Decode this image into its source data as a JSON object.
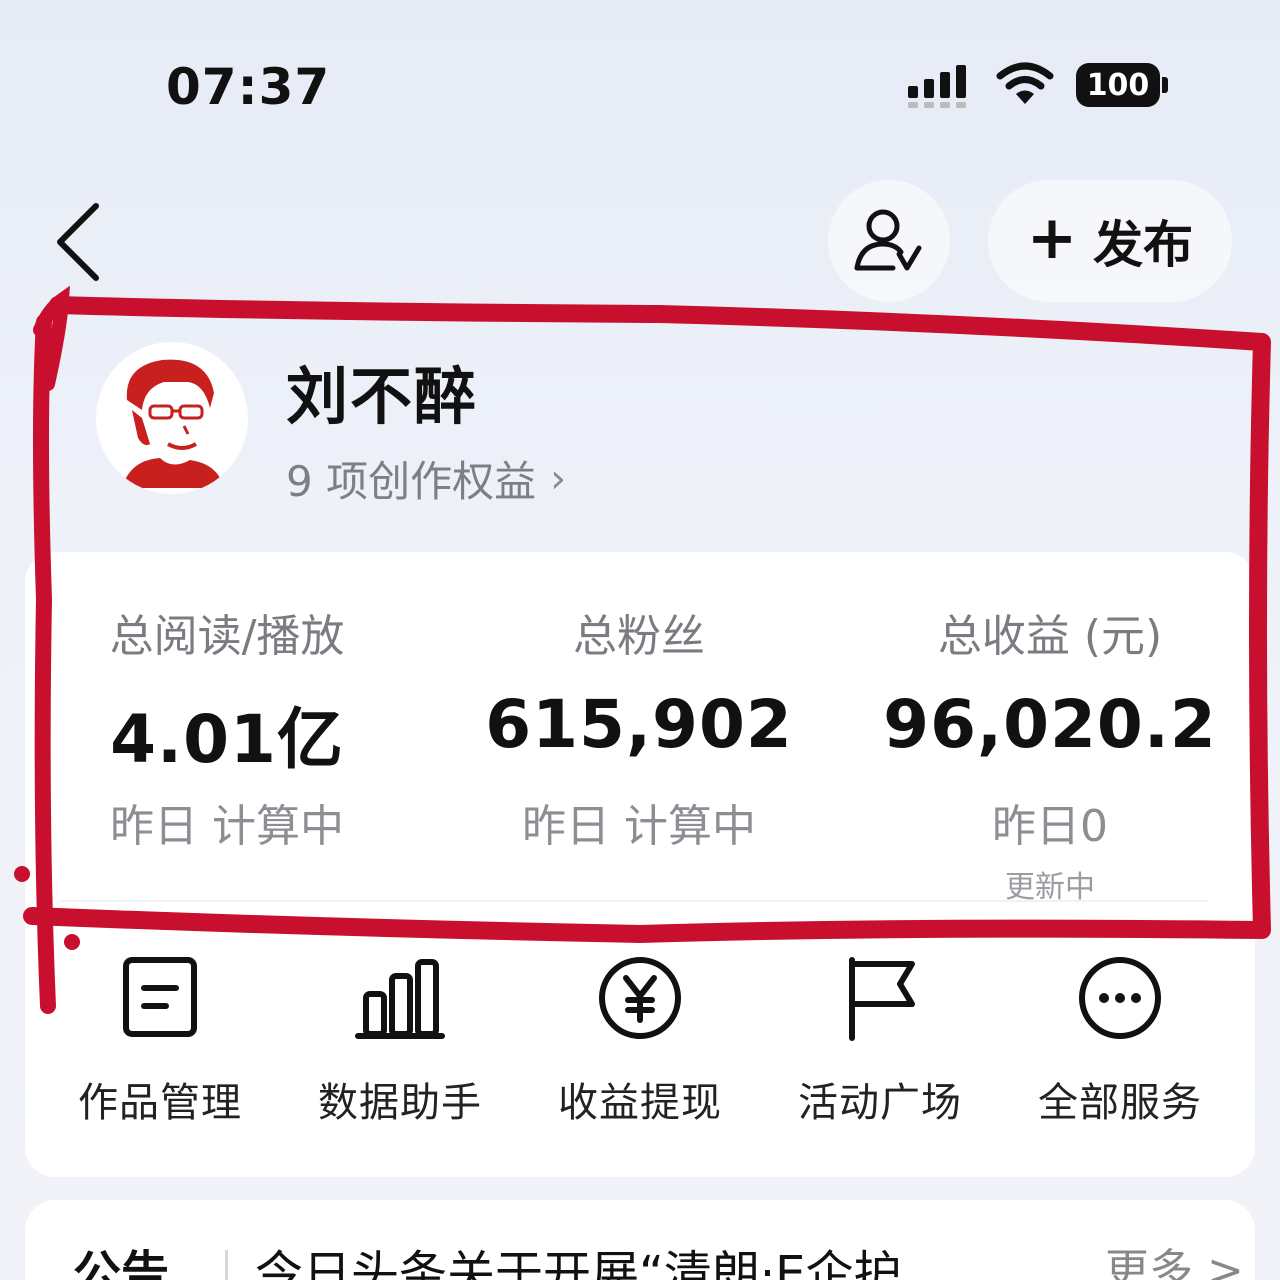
{
  "status_bar": {
    "time": "07:37",
    "battery": "100",
    "signal_icon": "cellular-signal-icon",
    "wifi_icon": "wifi-icon"
  },
  "header": {
    "back_icon": "chevron-left-icon",
    "follow_icon": "user-check-icon",
    "publish_label": "发布",
    "publish_icon": "plus-icon"
  },
  "profile": {
    "name": "刘不醉",
    "benefits": "9 项创作权益",
    "avatar_colors": {
      "accent": "#c8201e",
      "background": "#ffffff"
    }
  },
  "stats": [
    {
      "label": "总阅读/播放",
      "value": "4.01亿",
      "yesterday": "昨日 计算中",
      "sub": ""
    },
    {
      "label": "总粉丝",
      "value": "615,902",
      "yesterday": "昨日 计算中",
      "sub": ""
    },
    {
      "label": "总收益 (元)",
      "value": "96,020.2",
      "yesterday": "昨日0",
      "sub": "更新中"
    }
  ],
  "tools": [
    {
      "label": "作品管理",
      "icon": "document-icon"
    },
    {
      "label": "数据助手",
      "icon": "bar-chart-icon"
    },
    {
      "label": "收益提现",
      "icon": "yuan-icon"
    },
    {
      "label": "活动广场",
      "icon": "flag-icon"
    },
    {
      "label": "全部服务",
      "icon": "more-icon"
    }
  ],
  "notice": {
    "tag": "公告",
    "text": "今日头条关于开展“清朗·E企护…",
    "more": "更多 >"
  },
  "colors": {
    "highlight": "#c8102e",
    "text_primary": "#111111",
    "text_secondary": "#7a7c82"
  }
}
